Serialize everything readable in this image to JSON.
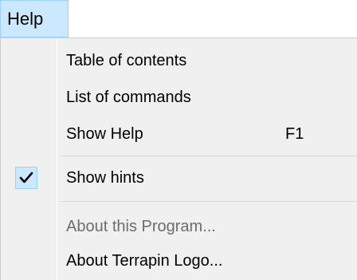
{
  "menubar": {
    "help_label": "Help"
  },
  "menu": {
    "items": [
      {
        "label": "Table of contents",
        "shortcut": ""
      },
      {
        "label": "List of commands",
        "shortcut": ""
      },
      {
        "label": "Show Help",
        "shortcut": "F1"
      },
      {
        "label": "Show hints",
        "shortcut": "",
        "checked": true
      },
      {
        "label": "About this Program...",
        "shortcut": "",
        "disabled": true
      },
      {
        "label": "About Terrapin Logo...",
        "shortcut": ""
      }
    ]
  },
  "colors": {
    "highlight_bg": "#cce8ff",
    "highlight_border": "#99d1ff",
    "menu_bg": "#f0f0f0",
    "disabled_text": "#6d6d6d"
  },
  "icons": {
    "check": "checkmark-icon"
  }
}
